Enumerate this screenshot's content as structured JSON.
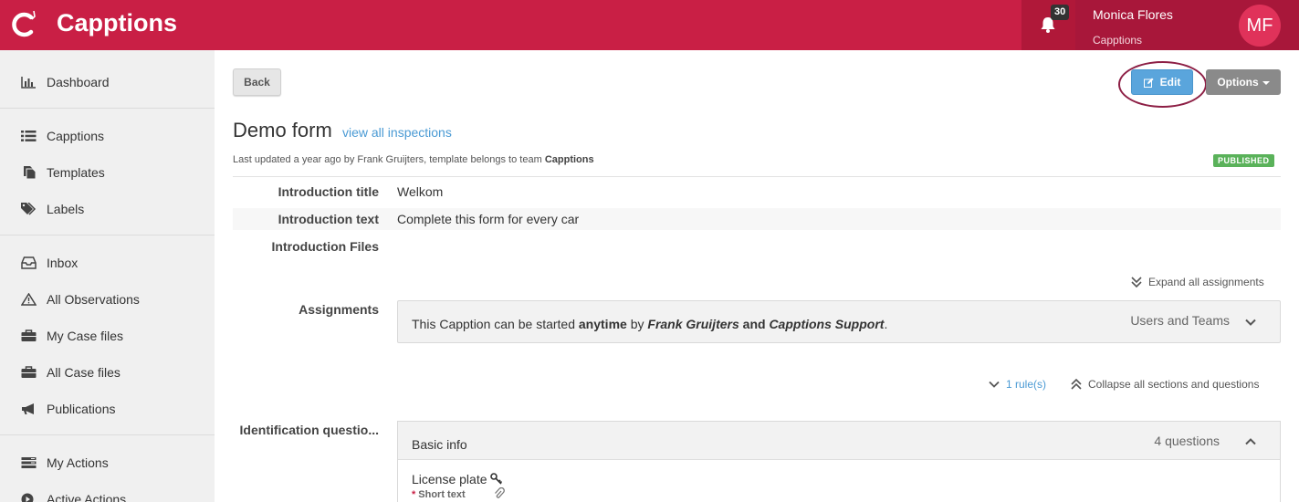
{
  "app": {
    "logo_text": "Capptions",
    "notifications_count": "30",
    "user_name": "Monica Flores",
    "user_team": "Capptions",
    "avatar_initials": "MF",
    "brand_color": "#c91f45"
  },
  "sidebar": {
    "items": [
      {
        "label": "Dashboard",
        "icon": "bar-chart-icon"
      },
      {
        "label": "Capptions",
        "icon": "list-icon"
      },
      {
        "label": "Templates",
        "icon": "copy-icon"
      },
      {
        "label": "Labels",
        "icon": "tags-icon"
      },
      {
        "label": "Inbox",
        "icon": "inbox-icon"
      },
      {
        "label": "All Observations",
        "icon": "warning-icon"
      },
      {
        "label": "My Case files",
        "icon": "briefcase-icon"
      },
      {
        "label": "All Case files",
        "icon": "briefcase-icon"
      },
      {
        "label": "Publications",
        "icon": "bullhorn-icon"
      },
      {
        "label": "My Actions",
        "icon": "tasks-icon"
      },
      {
        "label": "Active Actions",
        "icon": "play-circle-icon"
      }
    ]
  },
  "toolbar": {
    "back_label": "Back",
    "edit_label": "Edit",
    "options_label": "Options"
  },
  "page": {
    "title": "Demo form",
    "view_all_link": "view all inspections",
    "meta_prefix": "Last updated a year ago by Frank Gruijters, template belongs to team ",
    "meta_team": "Capptions",
    "status_badge": "PUBLISHED"
  },
  "fields": {
    "intro_title_label": "Introduction title",
    "intro_title_value": "Welkom",
    "intro_text_label": "Introduction text",
    "intro_text_value": "Complete this form for every car",
    "intro_files_label": "Introduction Files",
    "expand_all": "Expand all assignments",
    "assignments_label": "Assignments",
    "assign_text_1": "This Capption can be started ",
    "assign_text_anytime": "anytime",
    "assign_text_by": " by ",
    "assign_text_person": "Frank Gruijters",
    "assign_text_and": " and ",
    "assign_text_team": "Capptions Support",
    "assign_text_end": ".",
    "assign_right": "Users and Teams",
    "rules_link": "1 rule(s)",
    "collapse_all": "Collapse all sections and questions",
    "identification_label": "Identification questio..."
  },
  "section": {
    "title": "Basic info",
    "count": "4 questions",
    "question_name": "License plate",
    "question_type": "Short text",
    "required_mark": "*"
  }
}
